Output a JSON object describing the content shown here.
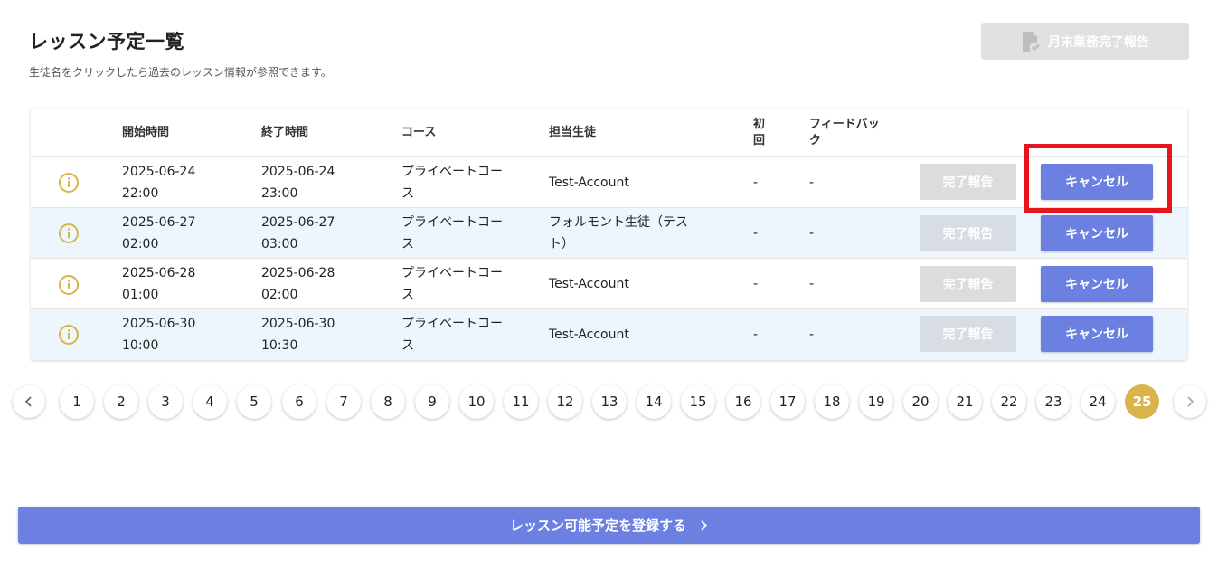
{
  "header": {
    "title": "レッスン予定一覧",
    "subtitle": "生徒名をクリックしたら過去のレッスン情報が参照できます。",
    "report_button_label": "月末業務完了報告",
    "report_button_icon": "document-check-icon"
  },
  "table": {
    "columns": {
      "start": "開始時間",
      "end": "終了時間",
      "course": "コース",
      "student": "担当生徒",
      "first_line1": "初",
      "first_line2": "回",
      "feedback_line1": "フィードバッ",
      "feedback_line2": "ク"
    },
    "rows": [
      {
        "start_date": "2025-06-24",
        "start_time": "22:00",
        "end_date": "2025-06-24",
        "end_time": "23:00",
        "course_line1": "プライベートコー",
        "course_line2": "ス",
        "student_line1": "Test-Account",
        "student_line2": "",
        "first": "-",
        "feedback": "-",
        "done_label": "完了報告",
        "cancel_label": "キャンセル"
      },
      {
        "start_date": "2025-06-27",
        "start_time": "02:00",
        "end_date": "2025-06-27",
        "end_time": "03:00",
        "course_line1": "プライベートコー",
        "course_line2": "ス",
        "student_line1": "フォルモント生徒（テス",
        "student_line2": "ト）",
        "first": "-",
        "feedback": "-",
        "done_label": "完了報告",
        "cancel_label": "キャンセル"
      },
      {
        "start_date": "2025-06-28",
        "start_time": "01:00",
        "end_date": "2025-06-28",
        "end_time": "02:00",
        "course_line1": "プライベートコー",
        "course_line2": "ス",
        "student_line1": "Test-Account",
        "student_line2": "",
        "first": "-",
        "feedback": "-",
        "done_label": "完了報告",
        "cancel_label": "キャンセル"
      },
      {
        "start_date": "2025-06-30",
        "start_time": "10:00",
        "end_date": "2025-06-30",
        "end_time": "10:30",
        "course_line1": "プライベートコー",
        "course_line2": "ス",
        "student_line1": "Test-Account",
        "student_line2": "",
        "first": "-",
        "feedback": "-",
        "done_label": "完了報告",
        "cancel_label": "キャンセル"
      }
    ],
    "info_icon": "info-circle-icon",
    "info_icon_color": "#d9b44a"
  },
  "pagination": {
    "pages": [
      "1",
      "2",
      "3",
      "4",
      "5",
      "6",
      "7",
      "8",
      "9",
      "10",
      "11",
      "12",
      "13",
      "14",
      "15",
      "16",
      "17",
      "18",
      "19",
      "20",
      "21",
      "22",
      "23",
      "24",
      "25"
    ],
    "current": "25",
    "prev_icon": "chevron-left-icon",
    "next_icon": "chevron-right-icon",
    "active_color": "#d9b44a"
  },
  "footer": {
    "register_label": "レッスン可能予定を登録する",
    "register_icon": "chevron-right-icon"
  },
  "colors": {
    "primary": "#6b80e0",
    "highlight": "#e5141f",
    "disabled": "#dcdcdc",
    "row_alt": "#eef6fd"
  }
}
